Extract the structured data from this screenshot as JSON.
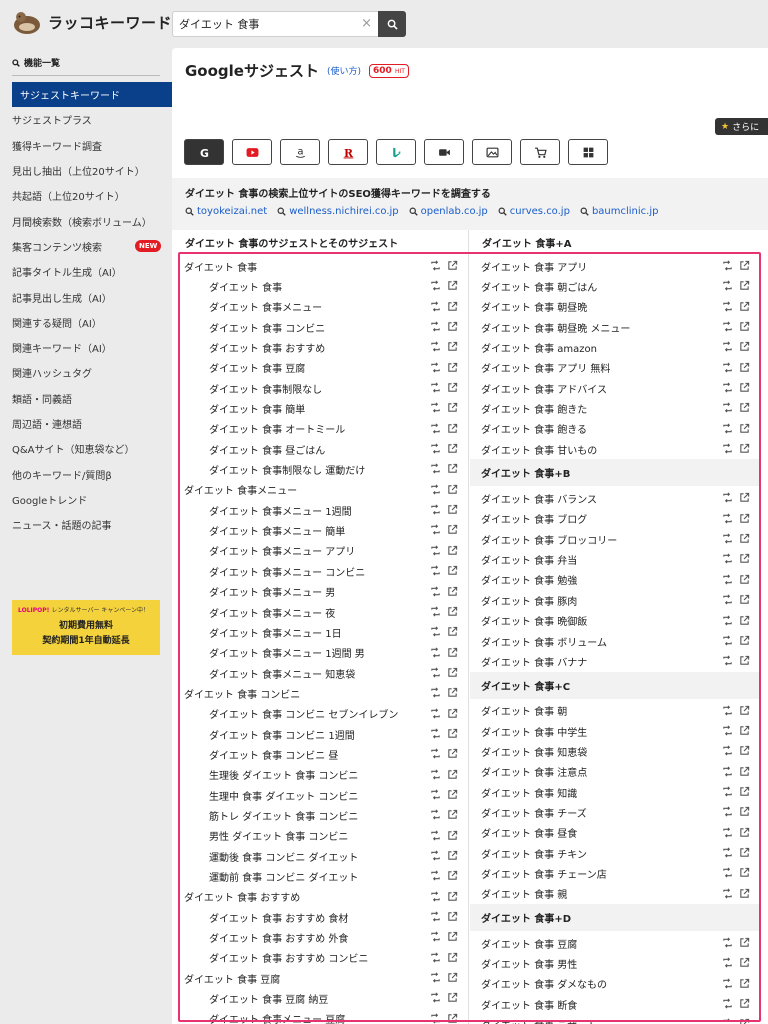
{
  "app": {
    "logo_text": "ラッコキーワード"
  },
  "search": {
    "value": "ダイエット 食事"
  },
  "sidebar": {
    "heading": "機能一覧",
    "items": [
      {
        "label": "サジェストキーワード",
        "active": true
      },
      {
        "label": "サジェストプラス"
      },
      {
        "label": "獲得キーワード調査"
      },
      {
        "label": "見出し抽出（上位20サイト）"
      },
      {
        "label": "共起語（上位20サイト）"
      },
      {
        "label": "月間検索数（検索ボリューム）"
      },
      {
        "label": "集客コンテンツ検索",
        "badge": "NEW"
      },
      {
        "label": "記事タイトル生成（AI）"
      },
      {
        "label": "記事見出し生成（AI）"
      },
      {
        "label": "関連する疑問（AI）"
      },
      {
        "label": "関連キーワード（AI）"
      },
      {
        "label": "関連ハッシュタグ"
      },
      {
        "label": "類語・同義語"
      },
      {
        "label": "周辺語・連想語"
      },
      {
        "label": "Q&Aサイト（知恵袋など）"
      },
      {
        "label": "他のキーワード/質問β"
      },
      {
        "label": "Googleトレンド"
      },
      {
        "label": "ニュース・話題の記事"
      }
    ],
    "ad": {
      "brand": "LOLIPOP!",
      "brand_sub": "レンタルサーバー キャンペーン中！",
      "line1": "初期費用無料",
      "line2": "契約期間1年自動延長"
    }
  },
  "main": {
    "title": "Googleサジェスト",
    "usage_link": "(使い方)",
    "hit_count": "600",
    "hit_unit": "HIT",
    "more_label": "さらに",
    "engines": [
      "google-icon",
      "youtube-icon",
      "amazon-icon",
      "rakuten-icon",
      "bing-icon",
      "video-icon",
      "image-icon",
      "shopping-icon",
      "app-store-icon"
    ],
    "seo_title": "ダイエット 食事の検索上位サイトのSEO獲得キーワードを調査する",
    "seo_links": [
      "toyokeizai.net",
      "wellness.nichirei.co.jp",
      "openlab.co.jp",
      "curves.co.jp",
      "baumclinic.jp"
    ],
    "left_header": "ダイエット 食事のサジェストとそのサジェスト",
    "right_header": "ダイエット 食事+A"
  },
  "left_rows": [
    {
      "text": "ダイエット 食事",
      "level": 0
    },
    {
      "text": "ダイエット 食事",
      "level": 1
    },
    {
      "text": "ダイエット 食事メニュー",
      "level": 1
    },
    {
      "text": "ダイエット 食事 コンビニ",
      "level": 1
    },
    {
      "text": "ダイエット 食事 おすすめ",
      "level": 1
    },
    {
      "text": "ダイエット 食事 豆腐",
      "level": 1
    },
    {
      "text": "ダイエット 食事制限なし",
      "level": 1
    },
    {
      "text": "ダイエット 食事 簡単",
      "level": 1
    },
    {
      "text": "ダイエット 食事 オートミール",
      "level": 1
    },
    {
      "text": "ダイエット 食事 昼ごはん",
      "level": 1
    },
    {
      "text": "ダイエット 食事制限なし 運動だけ",
      "level": 1
    },
    {
      "text": "ダイエット 食事メニュー",
      "level": 0
    },
    {
      "text": "ダイエット 食事メニュー 1週間",
      "level": 1
    },
    {
      "text": "ダイエット 食事メニュー 簡単",
      "level": 1
    },
    {
      "text": "ダイエット 食事メニュー アプリ",
      "level": 1
    },
    {
      "text": "ダイエット 食事メニュー コンビニ",
      "level": 1
    },
    {
      "text": "ダイエット 食事メニュー 男",
      "level": 1
    },
    {
      "text": "ダイエット 食事メニュー 夜",
      "level": 1
    },
    {
      "text": "ダイエット 食事メニュー 1日",
      "level": 1
    },
    {
      "text": "ダイエット 食事メニュー 1週間 男",
      "level": 1
    },
    {
      "text": "ダイエット 食事メニュー 知恵袋",
      "level": 1
    },
    {
      "text": "ダイエット 食事 コンビニ",
      "level": 0
    },
    {
      "text": "ダイエット 食事 コンビニ セブンイレブン",
      "level": 1
    },
    {
      "text": "ダイエット 食事 コンビニ 1週間",
      "level": 1
    },
    {
      "text": "ダイエット 食事 コンビニ 昼",
      "level": 1
    },
    {
      "text": "生理後 ダイエット 食事 コンビニ",
      "level": 1
    },
    {
      "text": "生理中 食事 ダイエット コンビニ",
      "level": 1
    },
    {
      "text": "筋トレ ダイエット 食事 コンビニ",
      "level": 1
    },
    {
      "text": "男性 ダイエット 食事 コンビニ",
      "level": 1
    },
    {
      "text": "運動後 食事 コンビニ ダイエット",
      "level": 1
    },
    {
      "text": "運動前 食事 コンビニ ダイエット",
      "level": 1
    },
    {
      "text": "ダイエット 食事 おすすめ",
      "level": 0
    },
    {
      "text": "ダイエット 食事 おすすめ 食材",
      "level": 1
    },
    {
      "text": "ダイエット 食事 おすすめ 外食",
      "level": 1
    },
    {
      "text": "ダイエット 食事 おすすめ コンビニ",
      "level": 1
    },
    {
      "text": "ダイエット 食事 豆腐",
      "level": 0
    },
    {
      "text": "ダイエット 食事 豆腐 納豆",
      "level": 1
    },
    {
      "text": "ダイエット 食事メニュー 豆腐",
      "level": 1
    }
  ],
  "right_sections": [
    {
      "title": "",
      "rows": [
        "ダイエット 食事 アプリ",
        "ダイエット 食事 朝ごはん",
        "ダイエット 食事 朝昼晩",
        "ダイエット 食事 朝昼晩 メニュー",
        "ダイエット 食事 amazon",
        "ダイエット 食事 アプリ 無料",
        "ダイエット 食事 アドバイス",
        "ダイエット 食事 飽きた",
        "ダイエット 食事 飽きる",
        "ダイエット 食事 甘いもの"
      ]
    },
    {
      "title": "ダイエット 食事+B",
      "rows": [
        "ダイエット 食事 バランス",
        "ダイエット 食事 ブログ",
        "ダイエット 食事 ブロッコリー",
        "ダイエット 食事 弁当",
        "ダイエット 食事 勉強",
        "ダイエット 食事 豚肉",
        "ダイエット 食事 晩御飯",
        "ダイエット 食事 ボリューム",
        "ダイエット 食事 バナナ"
      ]
    },
    {
      "title": "ダイエット 食事+C",
      "rows": [
        "ダイエット 食事 朝",
        "ダイエット 食事 中学生",
        "ダイエット 食事 知恵袋",
        "ダイエット 食事 注意点",
        "ダイエット 食事 知識",
        "ダイエット 食事 チーズ",
        "ダイエット 食事 昼食",
        "ダイエット 食事 チキン",
        "ダイエット 食事 チェーン店",
        "ダイエット 食事 親"
      ]
    },
    {
      "title": "ダイエット 食事+D",
      "rows": [
        "ダイエット 食事 豆腐",
        "ダイエット 食事 男性",
        "ダイエット 食事 ダメなもの",
        "ダイエット 食事 断食",
        "ダイエット 食事 デザート"
      ]
    }
  ]
}
